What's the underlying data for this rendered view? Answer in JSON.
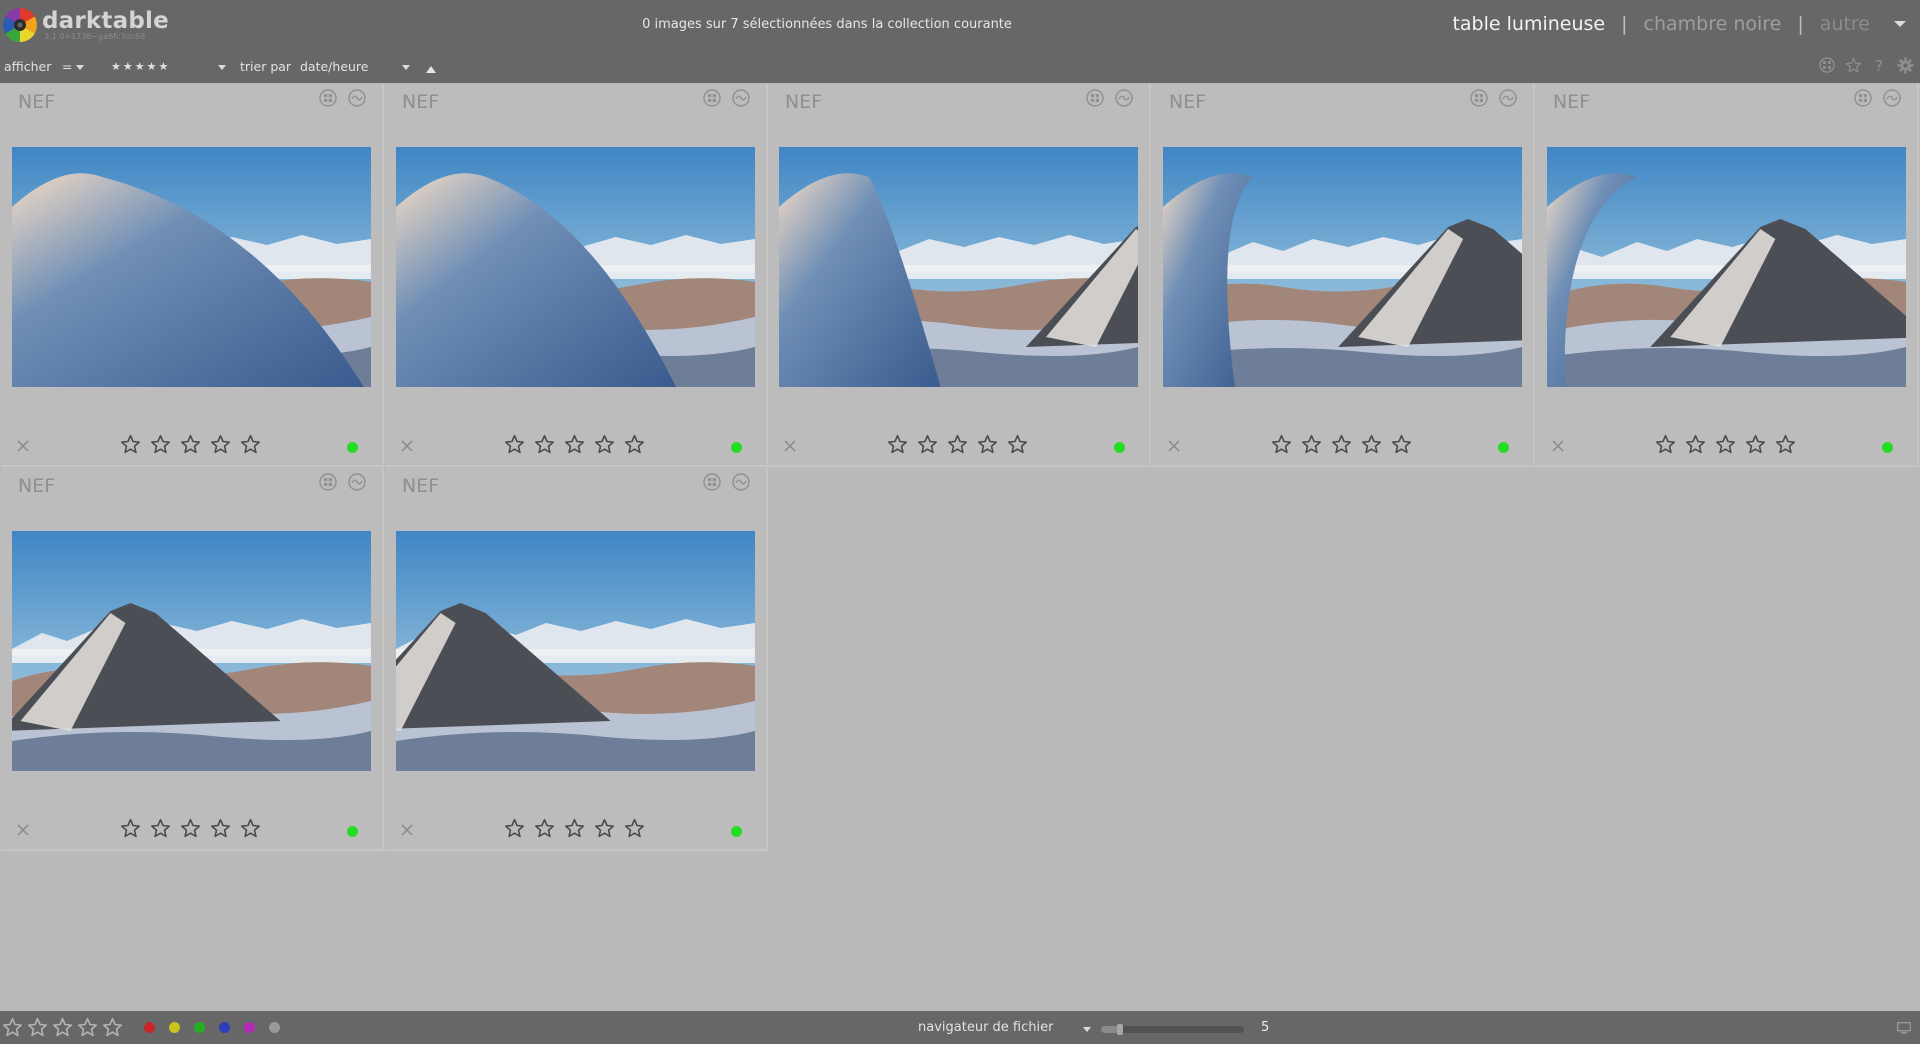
{
  "header": {
    "app_name": "darktable",
    "app_version": "3.1.0+1736~ga6fc3dc68",
    "collection_status": "0 images sur 7 sélectionnées dans la collection courante",
    "views": [
      {
        "label": "table lumineuse",
        "state": "active"
      },
      {
        "label": "chambre noire",
        "state": "normal"
      },
      {
        "label": "autre",
        "state": "dim"
      }
    ],
    "separator": "|"
  },
  "filterbar": {
    "show_label": "afficher",
    "comparator": "=",
    "rating_filter": "★★★★★",
    "sort_label": "trier par",
    "sort_value": "date/heure",
    "icons": [
      "grouping-icon",
      "star-overlay-icon",
      "help-icon",
      "preferences-icon"
    ]
  },
  "grid": {
    "thumbnails": [
      {
        "extension": "NEF",
        "rating": 0,
        "color_label": "#22dd22",
        "scene": 1
      },
      {
        "extension": "NEF",
        "rating": 0,
        "color_label": "#22dd22",
        "scene": 2
      },
      {
        "extension": "NEF",
        "rating": 0,
        "color_label": "#22dd22",
        "scene": 3
      },
      {
        "extension": "NEF",
        "rating": 0,
        "color_label": "#22dd22",
        "scene": 4
      },
      {
        "extension": "NEF",
        "rating": 0,
        "color_label": "#22dd22",
        "scene": 5
      },
      {
        "extension": "NEF",
        "rating": 0,
        "color_label": "#22dd22",
        "scene": 6
      },
      {
        "extension": "NEF",
        "rating": 0,
        "color_label": "#22dd22",
        "scene": 7
      }
    ]
  },
  "bottombar": {
    "color_filters": [
      "#c8242a",
      "#c8c41e",
      "#22b022",
      "#2a3fb8",
      "#b528b8",
      "#9a9a9a"
    ],
    "module": "navigateur de fichier",
    "zoom_level": "5",
    "zoom_fraction": 0.13
  },
  "colors": {
    "panel": "#676767",
    "background": "#b9b9b9",
    "star_stroke": "#4a4a4a"
  }
}
